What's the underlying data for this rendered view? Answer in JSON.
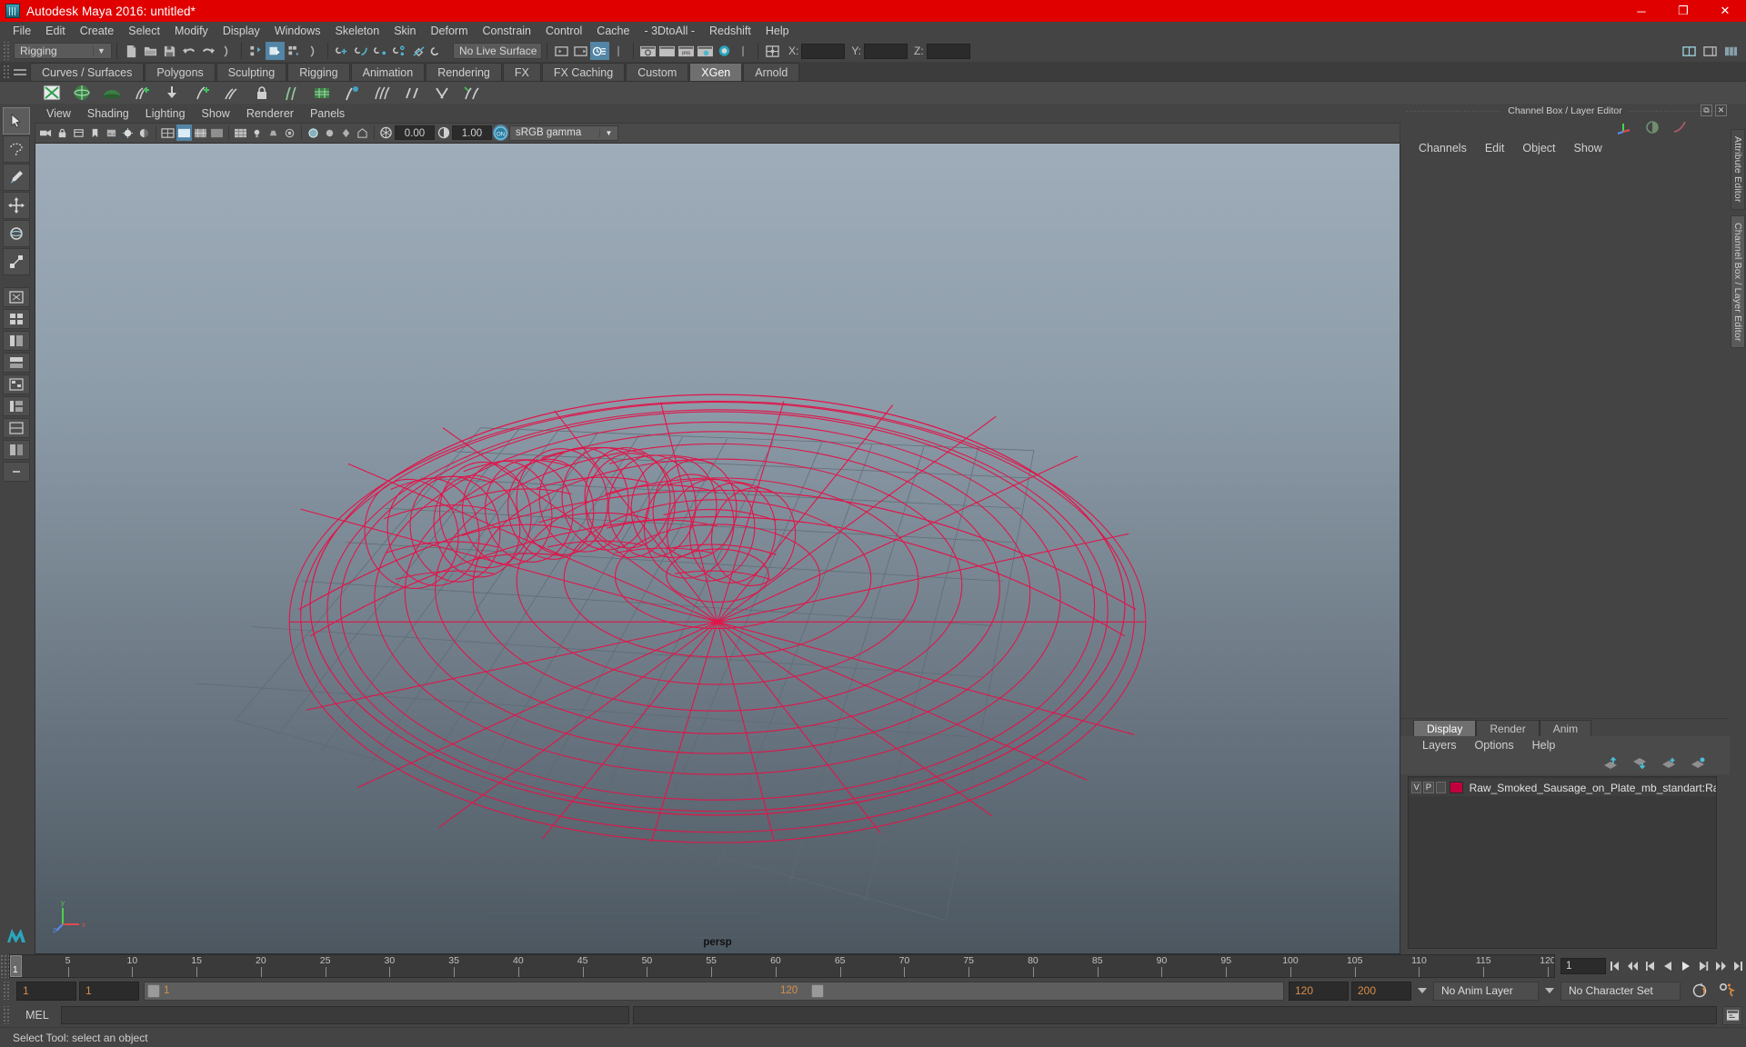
{
  "window": {
    "title": "Autodesk Maya 2016: untitled*",
    "app_icon": "maya-icon",
    "minimize": "─",
    "maximize": "❐",
    "close": "✕",
    "titlebar_color": "#e00000"
  },
  "menubar": {
    "items": [
      "File",
      "Edit",
      "Create",
      "Select",
      "Modify",
      "Display",
      "Windows",
      "Skeleton",
      "Skin",
      "Deform",
      "Constrain",
      "Control",
      "Cache",
      "- 3DtoAll -",
      "Redshift",
      "Help"
    ]
  },
  "statusline": {
    "menuset": {
      "value": "Rigging",
      "arrow": "▼"
    },
    "live_surface": {
      "value": "No Live Surface"
    },
    "coords": {
      "x_label": "X:",
      "x_value": "",
      "y_label": "Y:",
      "y_value": "",
      "z_label": "Z:",
      "z_value": ""
    },
    "icons": [
      "new-scene-icon",
      "open-scene-icon",
      "save-scene-icon",
      "undo-icon",
      "redo-icon",
      "select-hierarchy-icon",
      "select-object-icon",
      "select-component-icon",
      "snap-grid-icon",
      "snap-curve-icon",
      "snap-point-icon",
      "snap-projected-center-icon",
      "snap-view-plane-icon",
      "make-live-icon",
      "show-hide-editor-icon",
      "render-view-icon",
      "render-current-frame-icon",
      "ipr-render-icon",
      "render-settings-icon",
      "hypershade-icon",
      "attribute-editor-icon"
    ]
  },
  "shelf": {
    "tabs": [
      "Curves / Surfaces",
      "Polygons",
      "Sculpting",
      "Rigging",
      "Animation",
      "Rendering",
      "FX",
      "FX Caching",
      "Custom",
      "XGen",
      "Arnold"
    ],
    "active_tab": "XGen",
    "buttons": [
      "xgen-editor-icon",
      "xgen-sphere-icon",
      "xgen-grass-icon",
      "xgen-add-icon",
      "xgen-down-icon",
      "xgen-add-desc-icon",
      "xgen-clump-icon",
      "xgen-lock-icon",
      "xgen-guide-icon",
      "xgen-group-icon",
      "xgen-sculpt-icon",
      "xgen-comb-icon",
      "xgen-noise-icon",
      "xgen-cut-icon",
      "xgen-part-icon"
    ]
  },
  "toolbox": {
    "tools": [
      {
        "name": "select-tool",
        "icon": "arrow-cursor-icon",
        "selected": true
      },
      {
        "name": "lasso-tool",
        "icon": "lasso-icon",
        "selected": false
      },
      {
        "name": "paint-select-tool",
        "icon": "brush-icon",
        "selected": false
      },
      {
        "name": "move-tool",
        "icon": "move-arrows-icon",
        "selected": false
      },
      {
        "name": "rotate-tool",
        "icon": "rotate-ring-icon",
        "selected": false
      },
      {
        "name": "scale-tool",
        "icon": "scale-box-icon",
        "selected": false
      }
    ],
    "layout_presets": [
      "single-perspective-layout",
      "four-view-layout",
      "outliner-persp-layout",
      "persp-graph-layout",
      "hypershade-persp-layout",
      "outliner-persp-graph-layout",
      "persp-uv-layout",
      "two-stacked-layout",
      "collapse-icon"
    ],
    "maya_logo": "maya-logo-icon"
  },
  "viewport": {
    "panel_menus": [
      "View",
      "Shading",
      "Lighting",
      "Show",
      "Renderer",
      "Panels"
    ],
    "toolbar": {
      "exposure_value": "0.00",
      "gamma_value": "1.00",
      "color_management": "sRGB gamma",
      "dropdown_arrow": "▼",
      "icons": [
        "select-camera-icon",
        "lock-camera-icon",
        "bookmark-icon",
        "image-plane-icon",
        "two-sided-lighting-icon",
        "shadows-icon",
        "ao-icon",
        "motion-blur-icon",
        "multisample-icon",
        "wireframe-shading-icon",
        "wireframe-on-shaded-icon",
        "smooth-shade-icon",
        "flat-shade-icon",
        "textures-icon",
        "lights-icon",
        "xray-icon",
        "xray-joints-icon",
        "xray-active-components-icon",
        "isolate-select-icon",
        "grid-toggle-icon",
        "film-gate-icon",
        "resolution-gate-icon",
        "gate-mask-icon",
        "exposure-icon",
        "gamma-icon",
        "color-management-toggle-icon"
      ]
    },
    "camera_label": "persp",
    "axis_gizmo": {
      "x": "x",
      "y": "y",
      "z": "z"
    },
    "object_wireframe_color": "#e0154a"
  },
  "channel_box": {
    "panel_title": "Channel Box / Layer Editor",
    "float_icon": "⧉",
    "close_icon": "✕",
    "menus": [
      "Channels",
      "Edit",
      "Object",
      "Show"
    ],
    "toggle_icons": [
      "axis-manipulator-icon",
      "channel-speed-icon",
      "graph-curve-icon"
    ]
  },
  "layer_editor": {
    "tabs": [
      "Display",
      "Render",
      "Anim"
    ],
    "active_tab": "Display",
    "menus": [
      "Layers",
      "Options",
      "Help"
    ],
    "tool_icons": [
      "move-layer-up-icon",
      "move-layer-down-icon",
      "create-empty-layer-icon",
      "create-layer-from-selected-icon"
    ],
    "layers": [
      {
        "visibility": "V",
        "playback": "P",
        "shading": "",
        "color": "#c2003c",
        "name": "Raw_Smoked_Sausage_on_Plate_mb_standart:Raw_Smok"
      }
    ]
  },
  "attribute_tabs": {
    "items": [
      "Attribute Editor",
      "Channel Box / Layer Editor"
    ],
    "active": "Channel Box / Layer Editor"
  },
  "time_slider": {
    "start": 1,
    "end": 120,
    "current_frame": "1",
    "tick_labels": [
      "5",
      "10",
      "15",
      "20",
      "25",
      "30",
      "35",
      "40",
      "45",
      "50",
      "55",
      "60",
      "65",
      "70",
      "75",
      "80",
      "85",
      "90",
      "95",
      "100",
      "105",
      "110",
      "115",
      "120"
    ],
    "frame_field": "1",
    "playback_buttons": [
      "go-to-start-icon",
      "step-back-frame-icon",
      "step-back-key-icon",
      "play-backwards-icon",
      "play-forwards-icon",
      "step-forward-key-icon",
      "step-forward-frame-icon",
      "go-to-end-icon"
    ]
  },
  "range_slider": {
    "anim_start": "1",
    "range_start": "1",
    "range_label_left": "1",
    "range_label_right": "120",
    "range_end": "120",
    "anim_end": "200",
    "anim_layer": "No Anim Layer",
    "character_set": "No Character Set",
    "auto_key_icon": "auto-key-icon",
    "anim_prefs_icon": "animation-preferences-icon"
  },
  "command_line": {
    "language_label": "MEL",
    "input_value": "",
    "output_value": "",
    "script_editor_icon": "script-editor-icon"
  },
  "status_bar": {
    "message": "Select Tool: select an object"
  }
}
